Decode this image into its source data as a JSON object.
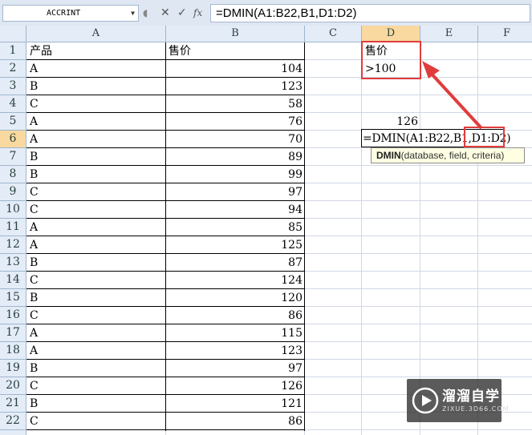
{
  "formula_bar": {
    "name_box": "ACCRINT",
    "cancel_icon": "✕",
    "enter_icon": "✓",
    "fx_label": "fx",
    "formula": "=DMIN(A1:B22,B1,D1:D2)"
  },
  "columns": [
    "A",
    "B",
    "C",
    "D",
    "E",
    "F"
  ],
  "rows": [
    "1",
    "2",
    "3",
    "4",
    "5",
    "6",
    "7",
    "8",
    "9",
    "10",
    "11",
    "12",
    "13",
    "14",
    "15",
    "16",
    "17",
    "18",
    "19",
    "20",
    "21",
    "22"
  ],
  "table": {
    "headers": [
      "产品",
      "售价"
    ],
    "rows": [
      [
        "A",
        "104"
      ],
      [
        "B",
        "123"
      ],
      [
        "C",
        "58"
      ],
      [
        "A",
        "76"
      ],
      [
        "A",
        "70"
      ],
      [
        "B",
        "89"
      ],
      [
        "B",
        "99"
      ],
      [
        "C",
        "97"
      ],
      [
        "C",
        "94"
      ],
      [
        "A",
        "85"
      ],
      [
        "A",
        "125"
      ],
      [
        "B",
        "87"
      ],
      [
        "C",
        "124"
      ],
      [
        "B",
        "120"
      ],
      [
        "C",
        "86"
      ],
      [
        "A",
        "115"
      ],
      [
        "A",
        "123"
      ],
      [
        "B",
        "97"
      ],
      [
        "C",
        "126"
      ],
      [
        "B",
        "121"
      ],
      [
        "C",
        "86"
      ]
    ]
  },
  "criteria": {
    "header": "售价",
    "value": ">100"
  },
  "d5_value": "126",
  "d6_editing": "=DMIN(A1:B22,B1,D1:D2)",
  "tooltip": {
    "func": "DMIN",
    "args": "(database, field, criteria)"
  },
  "watermark": {
    "title": "溜溜自学",
    "url": "ZIXUE.3D66.COM"
  },
  "colors": {
    "accent_red": "#e03c3c",
    "header_bg": "#e4ecf7",
    "selected_header": "#f9d99f"
  }
}
